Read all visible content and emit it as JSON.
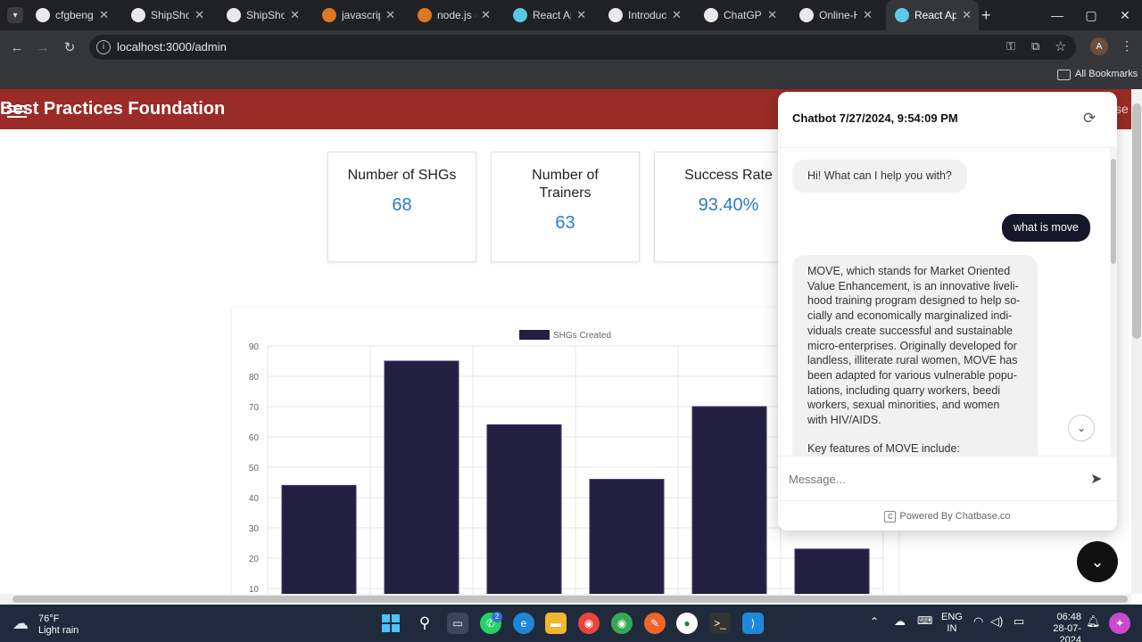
{
  "browser": {
    "tabs": [
      {
        "label": "cfgbengalu",
        "icon": "github-icon",
        "color": "#ffffff"
      },
      {
        "label": "ShipShop/",
        "icon": "github-icon",
        "color": "#ffffff"
      },
      {
        "label": "ShipShop",
        "icon": "app-icon",
        "color": "#ffffff"
      },
      {
        "label": "javascript",
        "icon": "stackoverflow-icon",
        "color": "#f48024"
      },
      {
        "label": "node.js - c",
        "icon": "stackoverflow-icon",
        "color": "#f48024"
      },
      {
        "label": "React App",
        "icon": "react-icon",
        "color": "#61dafb"
      },
      {
        "label": "Introducin",
        "icon": "openai-icon",
        "color": "#ffffff"
      },
      {
        "label": "ChatGPT",
        "icon": "chatgpt-icon",
        "color": "#ffffff"
      },
      {
        "label": "Online-Ho",
        "icon": "github-icon",
        "color": "#ffffff"
      },
      {
        "label": "React App",
        "icon": "react-icon",
        "color": "#61dafb",
        "active": true
      }
    ],
    "url": "localhost:3000/admin",
    "bookmarks_label": "All Bookmarks",
    "profile_initial": "A"
  },
  "header": {
    "title": "Best Practices Foundation",
    "right_fragment": "se"
  },
  "stats": [
    {
      "title": "Number of SHGs",
      "value": "68"
    },
    {
      "title": "Number of Trainers",
      "value": "63"
    },
    {
      "title": "Success Rate",
      "value": "93.40%"
    }
  ],
  "chart_data": {
    "type": "bar",
    "series": [
      {
        "name": "SHGs Created",
        "values": [
          44,
          85,
          64,
          46,
          70,
          23
        ],
        "color": "#231f42"
      }
    ],
    "categories": [
      "",
      "",
      "",
      "",
      "",
      ""
    ],
    "ylim": [
      0,
      90
    ],
    "yticks": [
      10,
      20,
      30,
      40,
      50,
      60,
      70,
      80,
      90
    ],
    "grid": true,
    "legend": "top"
  },
  "chatbot": {
    "title": "Chatbot 7/27/2024, 9:54:09 PM",
    "messages": [
      {
        "role": "bot",
        "text": "Hi! What can I help you with?"
      },
      {
        "role": "user",
        "text": "what is move"
      },
      {
        "role": "bot",
        "text": "MOVE, which stands for Market Oriented Value Enhancement, is an innovative liveli-hood training program designed to help so-cially and economically marginalized indi-viduals create successful and sustainable micro-enterprises. Originally developed for landless, illiterate rural women, MOVE has been adapted for various vulnerable popu-lations, including quarry workers, beedi workers, sexual minorities, and women with HIV/AIDS."
      },
      {
        "role": "bot",
        "text": "Key features of MOVE include:"
      }
    ],
    "input_placeholder": "Message...",
    "powered": "Powered By Chatbase.co"
  },
  "taskbar": {
    "weather_temp": "76°F",
    "weather_text": "Light rain",
    "lang_top": "ENG",
    "lang_bottom": "IN",
    "time": "06:48",
    "date": "28-07-2024",
    "whatsapp_badge": "2"
  }
}
